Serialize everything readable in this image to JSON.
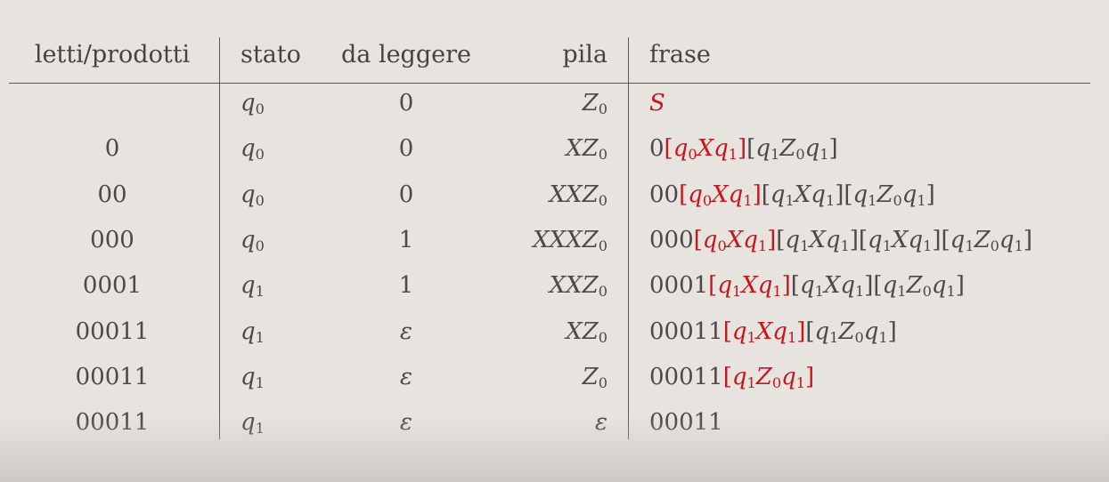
{
  "table": {
    "headers": {
      "letti": "letti/prodotti",
      "stato": "stato",
      "da_leggere": "da leggere",
      "pila": "pila",
      "frase": "frase"
    },
    "rows": [
      {
        "letti": "",
        "stato": "q0",
        "da_leggere": "0",
        "pila": "Z0",
        "frase_prefix": "",
        "frase_red": "S",
        "frase_rest": ""
      },
      {
        "letti": "0",
        "stato": "q0",
        "da_leggere": "0",
        "pila": "XZ0",
        "frase_prefix": "0",
        "frase_red": "[q0Xq1]",
        "frase_rest": "[q1Z0q1]"
      },
      {
        "letti": "00",
        "stato": "q0",
        "da_leggere": "0",
        "pila": "XXZ0",
        "frase_prefix": "00",
        "frase_red": "[q0Xq1]",
        "frase_rest": "[q1Xq1][q1Z0q1]"
      },
      {
        "letti": "000",
        "stato": "q0",
        "da_leggere": "1",
        "pila": "XXXZ0",
        "frase_prefix": "000",
        "frase_red": "[q0Xq1]",
        "frase_rest": "[q1Xq1][q1Xq1][q1Z0q1]"
      },
      {
        "letti": "0001",
        "stato": "q1",
        "da_leggere": "1",
        "pila": "XXZ0",
        "frase_prefix": "0001",
        "frase_red": "[q1Xq1]",
        "frase_rest": "[q1Xq1][q1Z0q1]"
      },
      {
        "letti": "00011",
        "stato": "q1",
        "da_leggere": "ε",
        "pila": "XZ0",
        "frase_prefix": "00011",
        "frase_red": "[q1Xq1]",
        "frase_rest": "[q1Z0q1]"
      },
      {
        "letti": "00011",
        "stato": "q1",
        "da_leggere": "ε",
        "pila": "Z0",
        "frase_prefix": "00011",
        "frase_red": "[q1Z0q1]",
        "frase_rest": ""
      },
      {
        "letti": "00011",
        "stato": "q1",
        "da_leggere": "ε",
        "pila": "ε",
        "frase_prefix": "00011",
        "frase_red": "",
        "frase_rest": ""
      }
    ]
  },
  "colors": {
    "text": "#4a4a4a",
    "highlight": "#c8161d",
    "background": "#e7e3df"
  }
}
